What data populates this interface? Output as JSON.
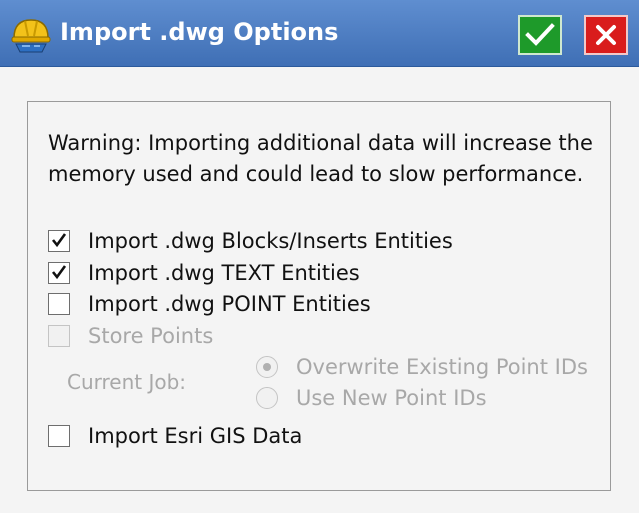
{
  "dialog": {
    "title": "Import .dwg Options",
    "icons": {
      "app": "hardhat-icon",
      "ok": "check-icon",
      "close": "close-icon"
    },
    "colors": {
      "titlebar": "#4a7bc0",
      "ok": "#1e9a2a",
      "close": "#d91c1c"
    }
  },
  "options": {
    "warning": "Warning: Importing additional data will increase the memory used and could lead to slow performance.",
    "blocks": {
      "label": "Import .dwg Blocks/Inserts Entities",
      "checked": true
    },
    "text": {
      "label": "Import .dwg TEXT Entities",
      "checked": true
    },
    "point": {
      "label": "Import .dwg POINT Entities",
      "checked": false
    },
    "store_points": {
      "label": "Store Points",
      "checked": false,
      "enabled": false
    },
    "current_job_label": "Current Job:",
    "overwrite": {
      "label": "Overwrite Existing Point IDs",
      "selected": true,
      "enabled": false
    },
    "use_new": {
      "label": "Use New Point IDs",
      "selected": false,
      "enabled": false
    },
    "esri": {
      "label": "Import Esri GIS Data",
      "checked": false
    }
  }
}
